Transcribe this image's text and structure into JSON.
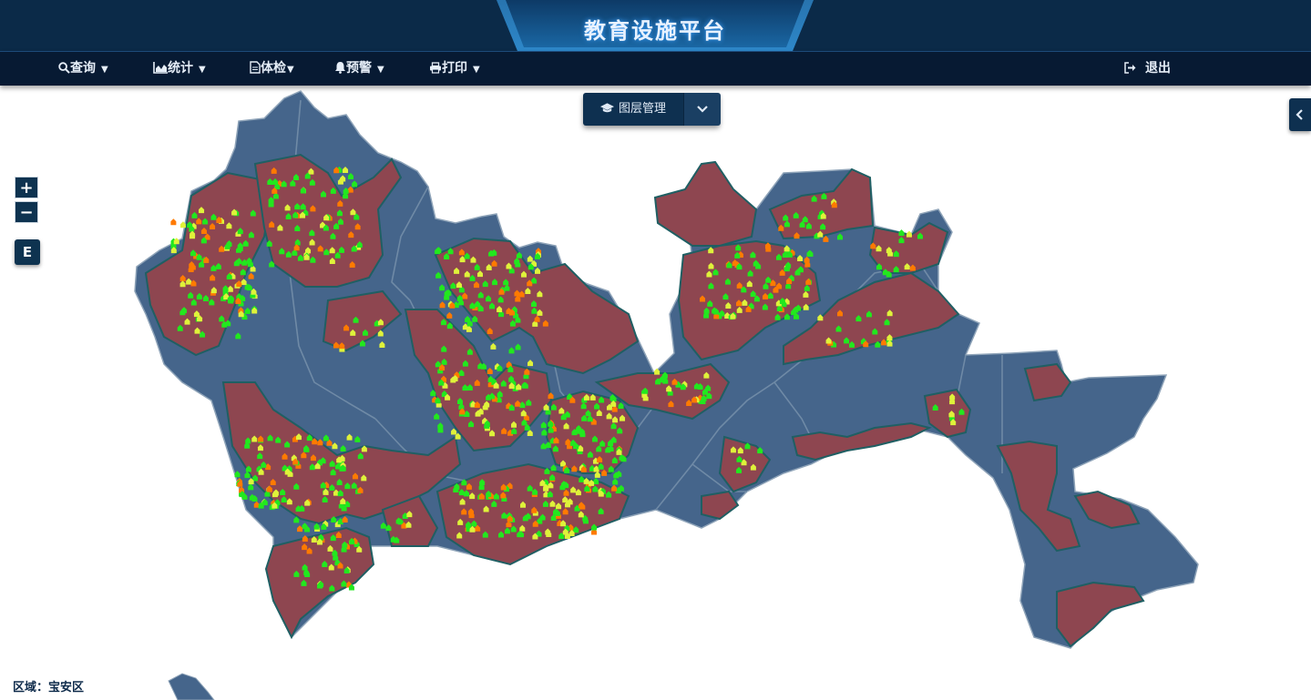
{
  "header": {
    "title": "教育设施平台"
  },
  "nav": {
    "items": [
      {
        "label": "查询",
        "icon": "search-icon"
      },
      {
        "label": "统计",
        "icon": "area-chart-icon"
      },
      {
        "label": "体检",
        "icon": "document-icon"
      },
      {
        "label": "预警",
        "icon": "bell-icon"
      },
      {
        "label": "打印",
        "icon": "print-icon"
      }
    ],
    "logout": {
      "label": "退出",
      "icon": "sign-out-icon"
    }
  },
  "layer_control": {
    "label": "图层管理",
    "icon": "graduation-cap-icon",
    "dropdown_icon": "chevron-down-icon"
  },
  "map_controls": {
    "zoom_in": "+",
    "zoom_out": "−",
    "extent": "E"
  },
  "status": {
    "region_prefix": "区域：",
    "region_value": "宝安区",
    "region_text": "区域：宝安区"
  },
  "legend_colors": {
    "district_fill": "#45658b",
    "selected_fill": "#8e4650",
    "boundary": "#1f5f63",
    "point_colors": [
      "#22e81e",
      "#dff23a",
      "#ff7a00"
    ]
  }
}
